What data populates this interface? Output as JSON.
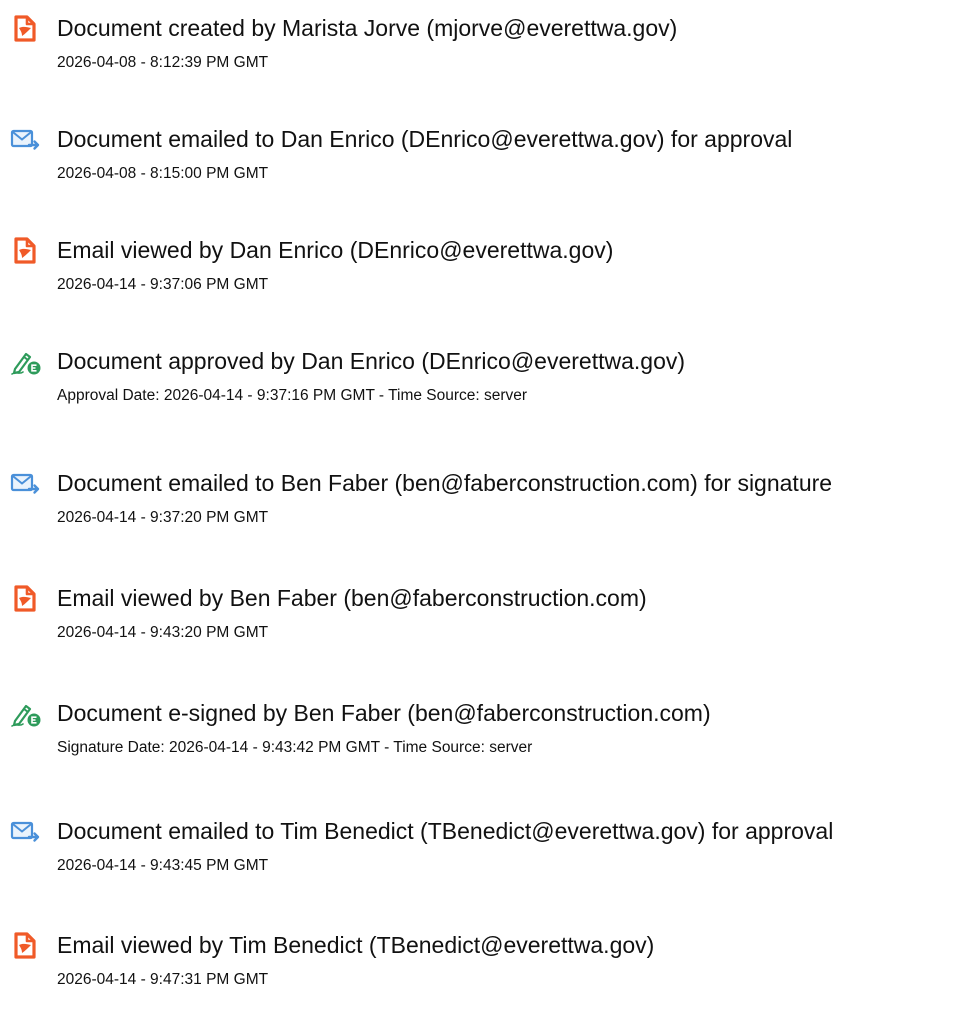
{
  "entries": [
    {
      "icon": "document-created-icon",
      "title": "Document created by Marista Jorve (mjorve@everettwa.gov)",
      "detail": "2026-04-08 - 8:12:39 PM GMT"
    },
    {
      "icon": "email-sent-icon",
      "title": "Document emailed to Dan Enrico (DEnrico@everettwa.gov) for approval",
      "detail": "2026-04-08 - 8:15:00 PM GMT"
    },
    {
      "icon": "document-viewed-icon",
      "title": "Email viewed by Dan Enrico (DEnrico@everettwa.gov)",
      "detail": "2026-04-14 - 9:37:06 PM GMT"
    },
    {
      "icon": "pen-approved-icon",
      "title": "Document approved by Dan Enrico (DEnrico@everettwa.gov)",
      "detail": "Approval Date: 2026-04-14 - 9:37:16 PM GMT - Time Source: server"
    },
    {
      "icon": "email-sent-icon",
      "title": "Document emailed to Ben Faber (ben@faberconstruction.com) for signature",
      "detail": "2026-04-14 - 9:37:20 PM GMT"
    },
    {
      "icon": "document-viewed-icon",
      "title": "Email viewed by Ben Faber (ben@faberconstruction.com)",
      "detail": "2026-04-14 - 9:43:20 PM GMT"
    },
    {
      "icon": "pen-signed-icon",
      "title": "Document e-signed by Ben Faber (ben@faberconstruction.com)",
      "detail": "Signature Date: 2026-04-14 - 9:43:42 PM GMT - Time Source: server"
    },
    {
      "icon": "email-sent-icon",
      "title": "Document emailed to Tim Benedict (TBenedict@everettwa.gov) for approval",
      "detail": "2026-04-14 - 9:43:45 PM GMT"
    },
    {
      "icon": "document-viewed-icon",
      "title": "Email viewed by Tim Benedict (TBenedict@everettwa.gov)",
      "detail": "2026-04-14 - 9:47:31 PM GMT"
    }
  ],
  "colors": {
    "document_icon": "#f05a28",
    "email_icon": "#4a90d9",
    "pen_icon": "#2e9b5b",
    "text": "#111111"
  }
}
